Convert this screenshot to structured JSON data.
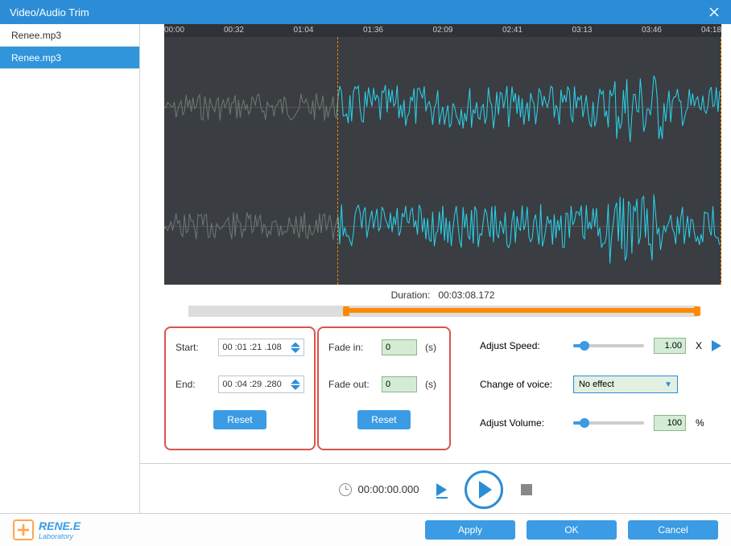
{
  "titlebar": {
    "title": "Video/Audio Trim"
  },
  "sidebar": {
    "items": [
      {
        "label": "Renee.mp3",
        "selected": false
      },
      {
        "label": "Renee.mp3",
        "selected": true
      }
    ]
  },
  "ruler": {
    "ticks": [
      "00:00",
      "00:32",
      "01:04",
      "01:36",
      "02:09",
      "02:41",
      "03:13",
      "03:46",
      "04:18"
    ]
  },
  "duration": {
    "label": "Duration:",
    "value": "00:03:08.172"
  },
  "trim": {
    "start_label": "Start:",
    "start_value": "00 :01 :21 .108",
    "end_label": "End:",
    "end_value": "00 :04 :29 .280",
    "reset": "Reset",
    "range_pct": {
      "start": 31,
      "end": 100
    }
  },
  "fade": {
    "in_label": "Fade in:",
    "in_value": "0",
    "out_label": "Fade out:",
    "out_value": "0",
    "unit": "(s)",
    "reset": "Reset"
  },
  "speed": {
    "label": "Adjust Speed:",
    "value": "1.00",
    "suffix": "X",
    "pct": 16
  },
  "voice": {
    "label": "Change of voice:",
    "value": "No effect"
  },
  "volume": {
    "label": "Adjust Volume:",
    "value": "100",
    "suffix": "%",
    "pct": 16
  },
  "playback": {
    "time": "00:00:00.000"
  },
  "footer": {
    "brand": "RENE.E",
    "brand_sub": "Laboratory",
    "apply": "Apply",
    "ok": "OK",
    "cancel": "Cancel"
  },
  "colors": {
    "accent": "#2c8dd6",
    "wave_active": "#2ad0e8",
    "wave_inactive": "#6d7771",
    "trim_orange": "#ff8a00",
    "highlight_border": "#d9534f"
  }
}
